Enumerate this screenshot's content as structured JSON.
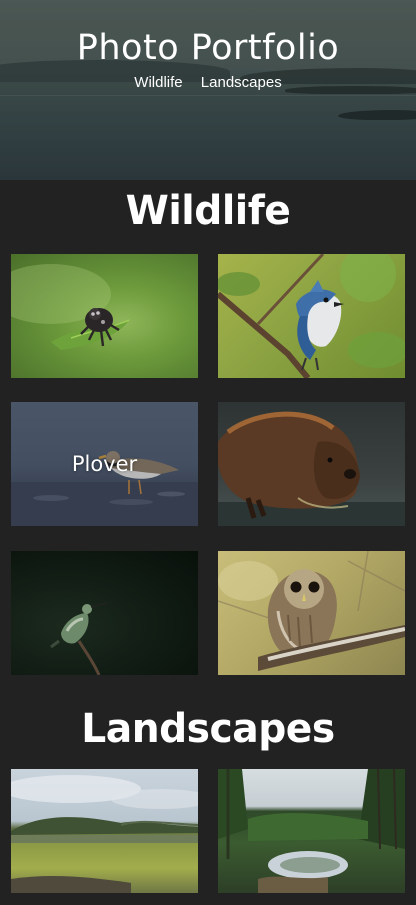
{
  "site": {
    "title": "Photo Portfolio",
    "nav": [
      {
        "label": "Wildlife"
      },
      {
        "label": "Landscapes"
      }
    ]
  },
  "sections": {
    "wildlife": {
      "heading": "Wildlife",
      "photos": [
        {
          "subject": "jumping-spider",
          "caption": ""
        },
        {
          "subject": "blue-jay",
          "caption": ""
        },
        {
          "subject": "plover",
          "caption": "Plover"
        },
        {
          "subject": "beaver",
          "caption": ""
        },
        {
          "subject": "hummingbird",
          "caption": ""
        },
        {
          "subject": "barred-owl",
          "caption": ""
        }
      ]
    },
    "landscapes": {
      "heading": "Landscapes",
      "photos": [
        {
          "subject": "marsh",
          "caption": ""
        },
        {
          "subject": "forest-pond",
          "caption": ""
        }
      ]
    }
  },
  "colors": {
    "background": "#222222",
    "text": "#ffffff"
  }
}
